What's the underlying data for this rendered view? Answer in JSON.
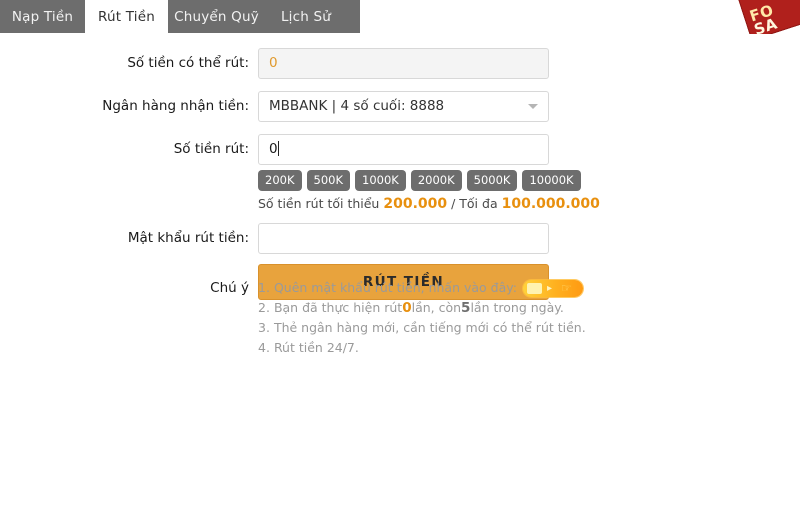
{
  "tabs": [
    {
      "label": "Nạp Tiền",
      "active": false
    },
    {
      "label": "Rút Tiền",
      "active": true
    },
    {
      "label": "Chuyển Quỹ",
      "active": false
    },
    {
      "label": "Lịch Sử",
      "active": false
    }
  ],
  "sale_badge": {
    "line1": "FO",
    "line2": "SA"
  },
  "form": {
    "available": {
      "label": "Số tiền có thể rút:",
      "value": "0",
      "placeholder": ""
    },
    "bank": {
      "label": "Ngân hàng nhận tiền:",
      "value": "MBBANK | 4 số cuối: 8888",
      "icon": "chevron-down-icon"
    },
    "amount": {
      "label": "Số tiền rút:",
      "value": "0",
      "placeholder": "",
      "quick_amounts": [
        "200K",
        "500K",
        "1000K",
        "2000K",
        "5000K",
        "10000K"
      ],
      "limits_prefix": "Số tiền rút tối thiểu",
      "limits_min": "200.000",
      "limits_sep": "/ Tối đa",
      "limits_max": "100.000.000"
    },
    "password": {
      "label": "Mật khẩu rút tiền:",
      "value": "",
      "placeholder": ""
    },
    "submit_label": "RÚT TIỀN"
  },
  "notes": {
    "label": "Chú ý",
    "items": [
      {
        "num": "1.",
        "text": "Quên mật khẩu rút tiền, nhấn vào đây:",
        "has_pill": true
      },
      {
        "num": "2.",
        "pre": "Bạn đã thực hiện rút",
        "bold_orange": "0",
        "mid": "lần, còn",
        "bold_gray": "5",
        "post": "lần trong ngày."
      },
      {
        "num": "3.",
        "text": "Thẻ ngân hàng mới, cần tiếng mới có thể rút tiền."
      },
      {
        "num": "4.",
        "text": "Rút tiền 24/7."
      }
    ]
  },
  "colors": {
    "tab_inactive_bg": "#6d6d6d",
    "accent_orange": "#e8900f",
    "button_orange": "#e8a33d",
    "chip_gray": "#6d6d6d",
    "note_gray": "#9a9a9a",
    "badge_red": "#b0201c"
  }
}
